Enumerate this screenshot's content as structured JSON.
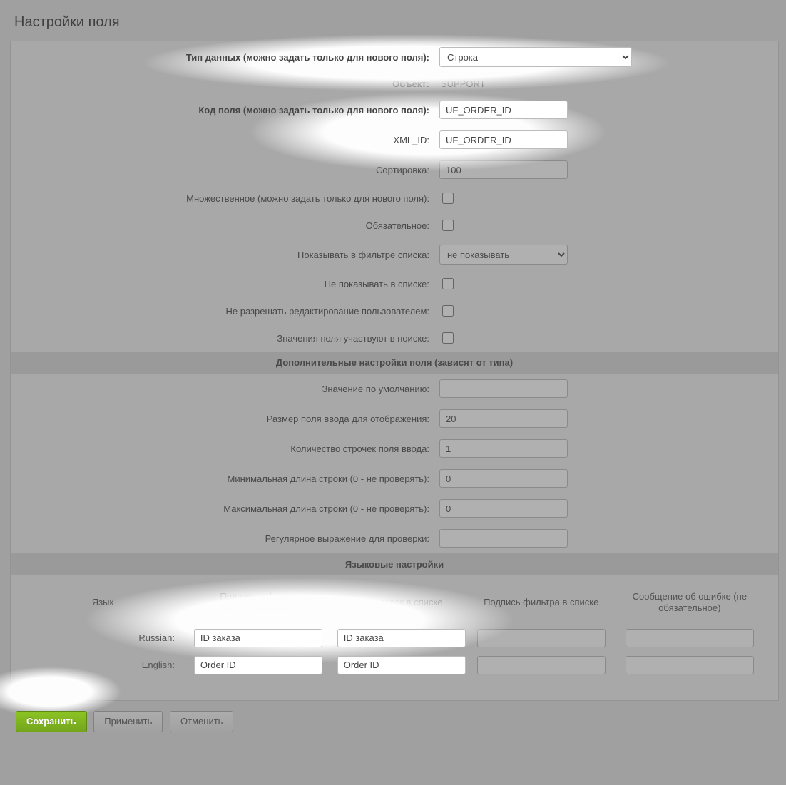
{
  "title": "Настройки поля",
  "rows": {
    "data_type": {
      "label": "Тип данных (можно задать только для нового поля):",
      "value": "Строка"
    },
    "object": {
      "label": "Объект:",
      "value": "SUPPORT"
    },
    "field_code": {
      "label": "Код поля (можно задать только для нового поля):",
      "value": "UF_ORDER_ID"
    },
    "xml_id": {
      "label": "XML_ID:",
      "value": "UF_ORDER_ID"
    },
    "sort": {
      "label": "Сортировка:",
      "value": "100"
    },
    "multiple": {
      "label": "Множественное (можно задать только для нового поля):"
    },
    "required": {
      "label": "Обязательное:"
    },
    "show_filter": {
      "label": "Показывать в фильтре списка:",
      "value": "не показывать"
    },
    "hide_list": {
      "label": "Не показывать в списке:"
    },
    "no_edit": {
      "label": "Не разрешать редактирование пользователем:"
    },
    "in_search": {
      "label": "Значения поля участвуют в поиске:"
    }
  },
  "section_additional": "Дополнительные настройки поля (зависят от типа)",
  "addl": {
    "default": {
      "label": "Значение по умолчанию:",
      "value": ""
    },
    "size": {
      "label": "Размер поля ввода для отображения:",
      "value": "20"
    },
    "rows": {
      "label": "Количество строчек поля ввода:",
      "value": "1"
    },
    "min_len": {
      "label": "Минимальная длина строки (0 - не проверять):",
      "value": "0"
    },
    "max_len": {
      "label": "Максимальная длина строки (0 - не проверять):",
      "value": "0"
    },
    "regex": {
      "label": "Регулярное выражение для проверки:",
      "value": ""
    }
  },
  "section_lang": "Языковые настройки",
  "lang_cols": {
    "lang": "Язык",
    "edit_label": "Подпись в форме редактирования",
    "list_header": "Заголовок в списке",
    "filter_label": "Подпись фильтра в списке",
    "error_msg": "Сообщение об ошибке (не обязательное)"
  },
  "langs": [
    {
      "name": "Russian:",
      "edit_label": "ID заказа",
      "list_header": "ID заказа",
      "filter_label": "",
      "error_msg": ""
    },
    {
      "name": "English:",
      "edit_label": "Order ID",
      "list_header": "Order ID",
      "filter_label": "",
      "error_msg": ""
    }
  ],
  "buttons": {
    "save": "Сохранить",
    "apply": "Применить",
    "cancel": "Отменить"
  }
}
